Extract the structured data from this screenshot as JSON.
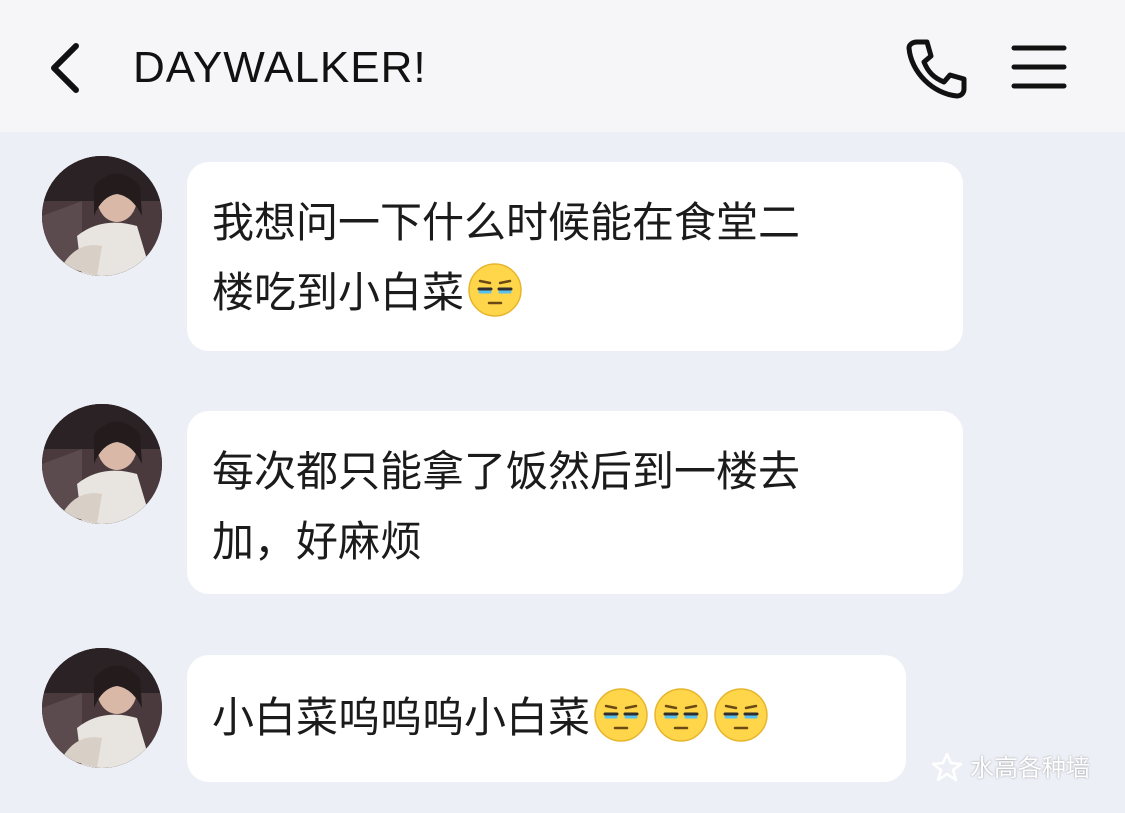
{
  "header": {
    "title": "DAYWALKER!"
  },
  "messages": [
    {
      "lines": [
        "我想问一下什么时候能在食堂二",
        "楼吃到小白菜"
      ],
      "emoji": [
        "unamused-face-icon"
      ]
    },
    {
      "lines": [
        "每次都只能拿了饭然后到一楼去",
        "加，好麻烦"
      ],
      "emoji": []
    },
    {
      "lines": [
        "小白菜呜呜呜小白菜"
      ],
      "emoji": [
        "unamused-face-icon",
        "unamused-face-icon",
        "unamused-face-icon"
      ]
    }
  ],
  "watermark": {
    "text": "水高各种墙"
  },
  "colors": {
    "header_bg": "#f6f6f8",
    "chat_bg": "#edeff6",
    "bubble_bg": "#ffffff",
    "text": "#1b1b1b"
  }
}
